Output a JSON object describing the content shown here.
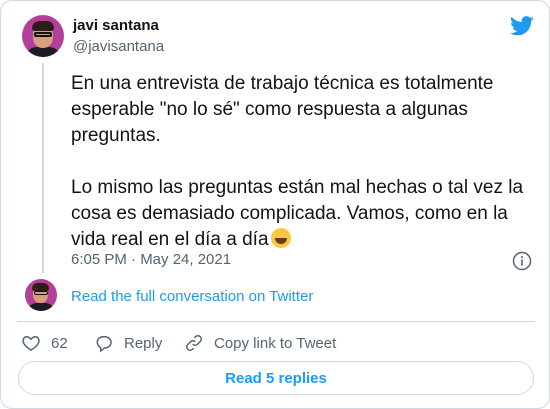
{
  "author": {
    "name": "javi santana",
    "handle": "@javisantana"
  },
  "tweet": {
    "text": "En una entrevista de trabajo técnica es totalmente esperable \"no lo sé\" como respuesta a algunas preguntas.\n\nLo mismo las preguntas están mal hechas o tal vez la cosa es demasiado complicada. Vamos, como en la vida real en el día a día",
    "emoji": "rolling-on-the-floor-laughing",
    "timestamp": "6:05 PM · May 24, 2021"
  },
  "conversation": {
    "link_label": "Read the full conversation on Twitter"
  },
  "actions": {
    "like_count": "62",
    "reply_label": "Reply",
    "copy_label": "Copy link to Tweet"
  },
  "replies_button": "Read 5 replies",
  "colors": {
    "accent": "#1d9bf0",
    "muted": "#536471",
    "border": "#cfd9de",
    "avatar_bg": "#b33f9b"
  }
}
